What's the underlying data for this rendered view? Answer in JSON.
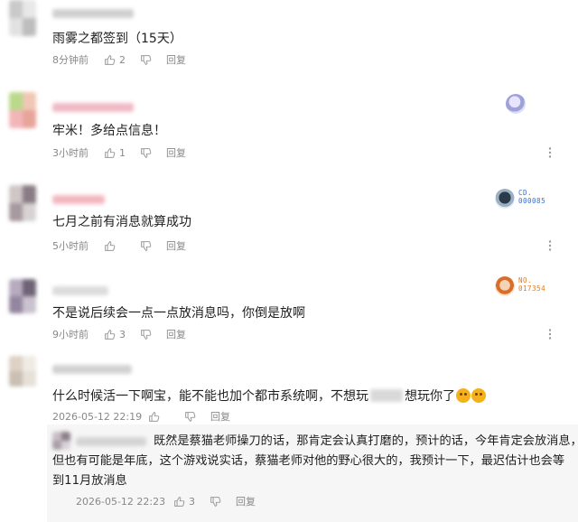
{
  "comments": [
    {
      "text": "雨雾之都签到（15天）",
      "time": "8分钟前",
      "likes": "2",
      "reply_label": "回复",
      "badge": null
    },
    {
      "text": "牢米！多给点信息！",
      "time": "3小时前",
      "likes": "1",
      "reply_label": "回复",
      "badge": {
        "icon": "character-avatar-icon",
        "lines": []
      }
    },
    {
      "text": "七月之前有消息就算成功",
      "time": "5小时前",
      "likes": "",
      "reply_label": "回复",
      "badge": {
        "icon": "character-avatar-icon",
        "lines": [
          "CD.",
          "000085"
        ]
      }
    },
    {
      "text": "不是说后续会一点一点放消息吗，你倒是放啊",
      "time": "9小时前",
      "likes": "3",
      "reply_label": "回复",
      "badge": {
        "icon": "character-avatar-icon",
        "lines": [
          "NO.",
          "017354"
        ]
      }
    },
    {
      "text_a": "什么时候活一下啊宝，能不能也加个都市系统啊，不想玩",
      "text_b": "想玩你了",
      "time": "2026-05-12 22:19",
      "likes": "",
      "reply_label": "回复",
      "emoji": "scream-face-emoji"
    }
  ],
  "nested_reply": {
    "lines": [
      "既然是蔡猫老师操刀的话，那肯定会认真打磨的，预计的话，今年肯定会放消息，",
      "但也有可能是年底，这个游戏说实话，蔡猫老师对他的野心很大的，我预计一下，最迟估计也会等",
      "到11月放消息"
    ],
    "time": "2026-05-12 22:23",
    "likes": "3",
    "reply_label": "回复"
  },
  "colors": {
    "meta_text": "#888888",
    "badge_blue": "#2f6fd6",
    "badge_orange": "#e07a1f"
  }
}
